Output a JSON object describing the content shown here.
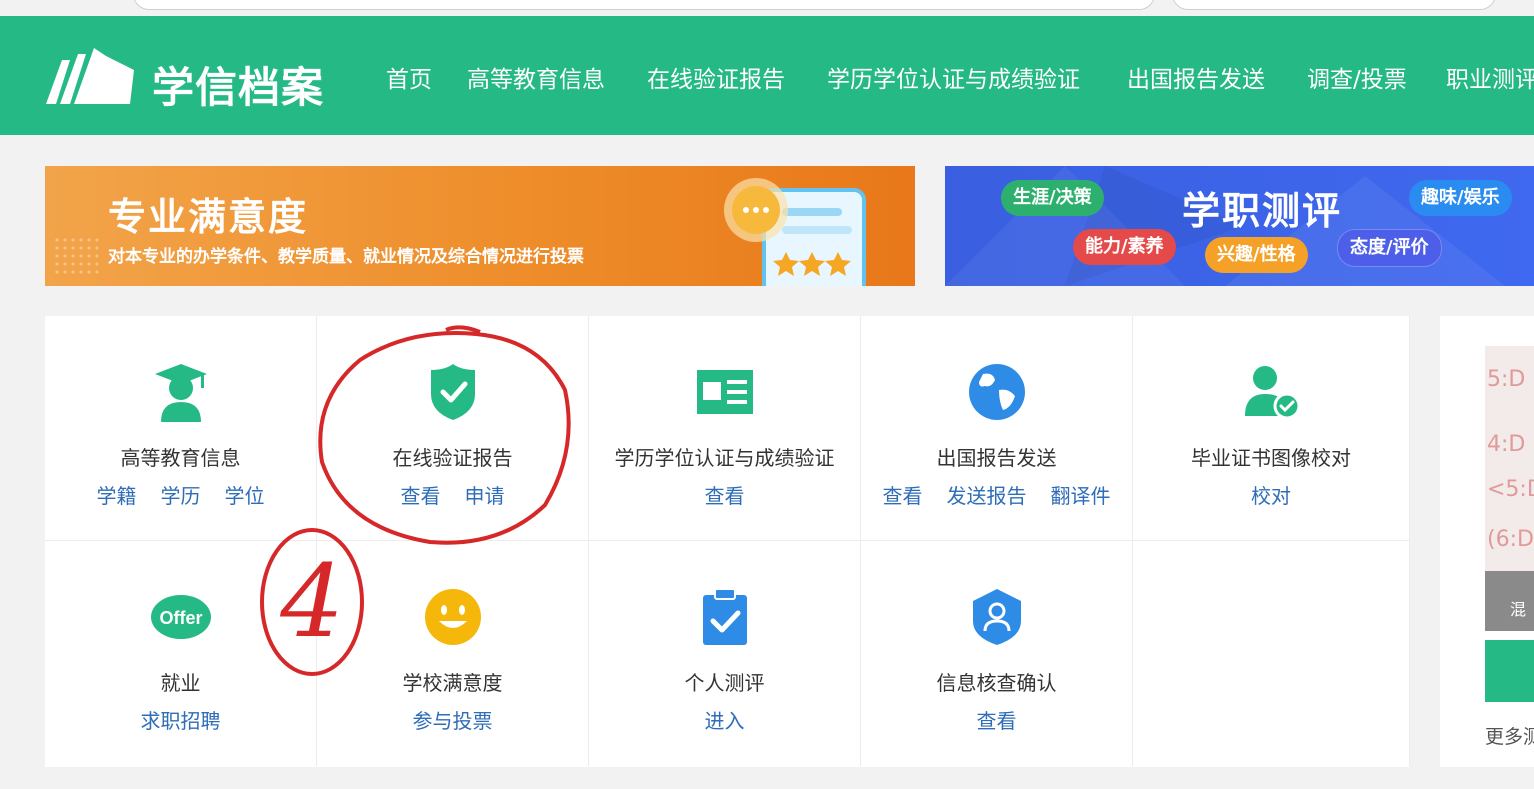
{
  "site": {
    "logo_text": "学信档案"
  },
  "nav": {
    "items": [
      "首页",
      "高等教育信息",
      "在线验证报告",
      "学历学位认证与成绩验证",
      "出国报告发送",
      "调查/投票",
      "职业测评"
    ]
  },
  "banners": {
    "satisfaction": {
      "title": "专业满意度",
      "subtitle": "对本专业的办学条件、教学质量、就业情况及综合情况进行投票"
    },
    "career_test": {
      "title": "学职测评",
      "tags": [
        "生涯/决策",
        "能力/素养",
        "兴趣/性格",
        "态度/评价",
        "趣味/娱乐"
      ]
    }
  },
  "services": [
    {
      "title": "高等教育信息",
      "icon": "graduate-icon",
      "links": [
        "学籍",
        "学历",
        "学位"
      ]
    },
    {
      "title": "在线验证报告",
      "icon": "shield-check-icon",
      "links": [
        "查看",
        "申请"
      ]
    },
    {
      "title": "学历学位认证与成绩验证",
      "icon": "id-card-icon",
      "links": [
        "查看"
      ]
    },
    {
      "title": "出国报告发送",
      "icon": "globe-icon",
      "links": [
        "查看",
        "发送报告",
        "翻译件"
      ]
    },
    {
      "title": "毕业证书图像校对",
      "icon": "user-check-icon",
      "links": [
        "校对"
      ]
    },
    {
      "title": "就业",
      "icon": "offer-icon",
      "links": [
        "求职招聘"
      ]
    },
    {
      "title": "学校满意度",
      "icon": "smile-icon",
      "links": [
        "参与投票"
      ]
    },
    {
      "title": "个人测评",
      "icon": "clipboard-check-icon",
      "links": [
        "进入"
      ]
    },
    {
      "title": "信息核查确认",
      "icon": "shield-user-icon",
      "links": [
        "查看"
      ]
    }
  ],
  "side": {
    "caption": "混",
    "more": "更多测"
  },
  "annotation": {
    "number": "4"
  },
  "colors": {
    "brand": "#25b986",
    "link": "#2f6db8",
    "annotation": "#d62828"
  }
}
